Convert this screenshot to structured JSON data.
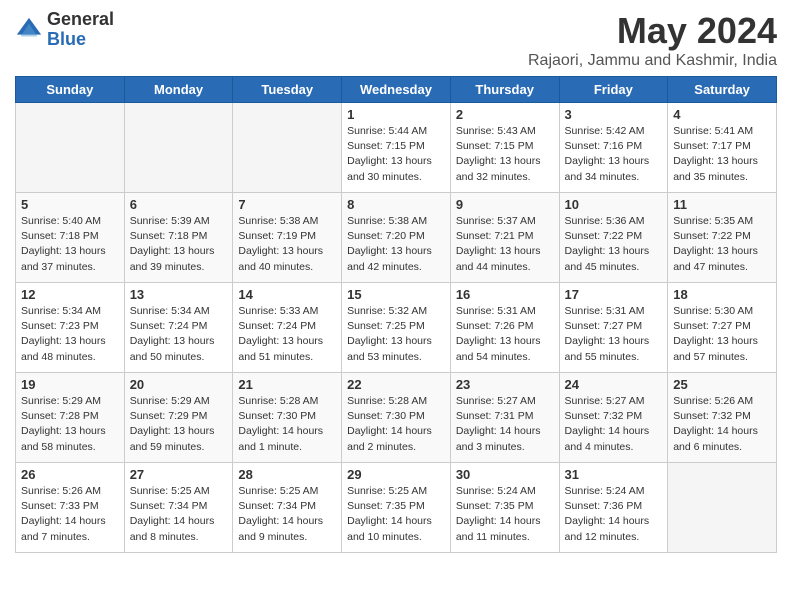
{
  "header": {
    "logo_general": "General",
    "logo_blue": "Blue",
    "title": "May 2024",
    "location": "Rajaori, Jammu and Kashmir, India"
  },
  "days_of_week": [
    "Sunday",
    "Monday",
    "Tuesday",
    "Wednesday",
    "Thursday",
    "Friday",
    "Saturday"
  ],
  "weeks": [
    [
      {
        "day": "",
        "info": ""
      },
      {
        "day": "",
        "info": ""
      },
      {
        "day": "",
        "info": ""
      },
      {
        "day": "1",
        "info": "Sunrise: 5:44 AM\nSunset: 7:15 PM\nDaylight: 13 hours\nand 30 minutes."
      },
      {
        "day": "2",
        "info": "Sunrise: 5:43 AM\nSunset: 7:15 PM\nDaylight: 13 hours\nand 32 minutes."
      },
      {
        "day": "3",
        "info": "Sunrise: 5:42 AM\nSunset: 7:16 PM\nDaylight: 13 hours\nand 34 minutes."
      },
      {
        "day": "4",
        "info": "Sunrise: 5:41 AM\nSunset: 7:17 PM\nDaylight: 13 hours\nand 35 minutes."
      }
    ],
    [
      {
        "day": "5",
        "info": "Sunrise: 5:40 AM\nSunset: 7:18 PM\nDaylight: 13 hours\nand 37 minutes."
      },
      {
        "day": "6",
        "info": "Sunrise: 5:39 AM\nSunset: 7:18 PM\nDaylight: 13 hours\nand 39 minutes."
      },
      {
        "day": "7",
        "info": "Sunrise: 5:38 AM\nSunset: 7:19 PM\nDaylight: 13 hours\nand 40 minutes."
      },
      {
        "day": "8",
        "info": "Sunrise: 5:38 AM\nSunset: 7:20 PM\nDaylight: 13 hours\nand 42 minutes."
      },
      {
        "day": "9",
        "info": "Sunrise: 5:37 AM\nSunset: 7:21 PM\nDaylight: 13 hours\nand 44 minutes."
      },
      {
        "day": "10",
        "info": "Sunrise: 5:36 AM\nSunset: 7:22 PM\nDaylight: 13 hours\nand 45 minutes."
      },
      {
        "day": "11",
        "info": "Sunrise: 5:35 AM\nSunset: 7:22 PM\nDaylight: 13 hours\nand 47 minutes."
      }
    ],
    [
      {
        "day": "12",
        "info": "Sunrise: 5:34 AM\nSunset: 7:23 PM\nDaylight: 13 hours\nand 48 minutes."
      },
      {
        "day": "13",
        "info": "Sunrise: 5:34 AM\nSunset: 7:24 PM\nDaylight: 13 hours\nand 50 minutes."
      },
      {
        "day": "14",
        "info": "Sunrise: 5:33 AM\nSunset: 7:24 PM\nDaylight: 13 hours\nand 51 minutes."
      },
      {
        "day": "15",
        "info": "Sunrise: 5:32 AM\nSunset: 7:25 PM\nDaylight: 13 hours\nand 53 minutes."
      },
      {
        "day": "16",
        "info": "Sunrise: 5:31 AM\nSunset: 7:26 PM\nDaylight: 13 hours\nand 54 minutes."
      },
      {
        "day": "17",
        "info": "Sunrise: 5:31 AM\nSunset: 7:27 PM\nDaylight: 13 hours\nand 55 minutes."
      },
      {
        "day": "18",
        "info": "Sunrise: 5:30 AM\nSunset: 7:27 PM\nDaylight: 13 hours\nand 57 minutes."
      }
    ],
    [
      {
        "day": "19",
        "info": "Sunrise: 5:29 AM\nSunset: 7:28 PM\nDaylight: 13 hours\nand 58 minutes."
      },
      {
        "day": "20",
        "info": "Sunrise: 5:29 AM\nSunset: 7:29 PM\nDaylight: 13 hours\nand 59 minutes."
      },
      {
        "day": "21",
        "info": "Sunrise: 5:28 AM\nSunset: 7:30 PM\nDaylight: 14 hours\nand 1 minute."
      },
      {
        "day": "22",
        "info": "Sunrise: 5:28 AM\nSunset: 7:30 PM\nDaylight: 14 hours\nand 2 minutes."
      },
      {
        "day": "23",
        "info": "Sunrise: 5:27 AM\nSunset: 7:31 PM\nDaylight: 14 hours\nand 3 minutes."
      },
      {
        "day": "24",
        "info": "Sunrise: 5:27 AM\nSunset: 7:32 PM\nDaylight: 14 hours\nand 4 minutes."
      },
      {
        "day": "25",
        "info": "Sunrise: 5:26 AM\nSunset: 7:32 PM\nDaylight: 14 hours\nand 6 minutes."
      }
    ],
    [
      {
        "day": "26",
        "info": "Sunrise: 5:26 AM\nSunset: 7:33 PM\nDaylight: 14 hours\nand 7 minutes."
      },
      {
        "day": "27",
        "info": "Sunrise: 5:25 AM\nSunset: 7:34 PM\nDaylight: 14 hours\nand 8 minutes."
      },
      {
        "day": "28",
        "info": "Sunrise: 5:25 AM\nSunset: 7:34 PM\nDaylight: 14 hours\nand 9 minutes."
      },
      {
        "day": "29",
        "info": "Sunrise: 5:25 AM\nSunset: 7:35 PM\nDaylight: 14 hours\nand 10 minutes."
      },
      {
        "day": "30",
        "info": "Sunrise: 5:24 AM\nSunset: 7:35 PM\nDaylight: 14 hours\nand 11 minutes."
      },
      {
        "day": "31",
        "info": "Sunrise: 5:24 AM\nSunset: 7:36 PM\nDaylight: 14 hours\nand 12 minutes."
      },
      {
        "day": "",
        "info": ""
      }
    ]
  ]
}
